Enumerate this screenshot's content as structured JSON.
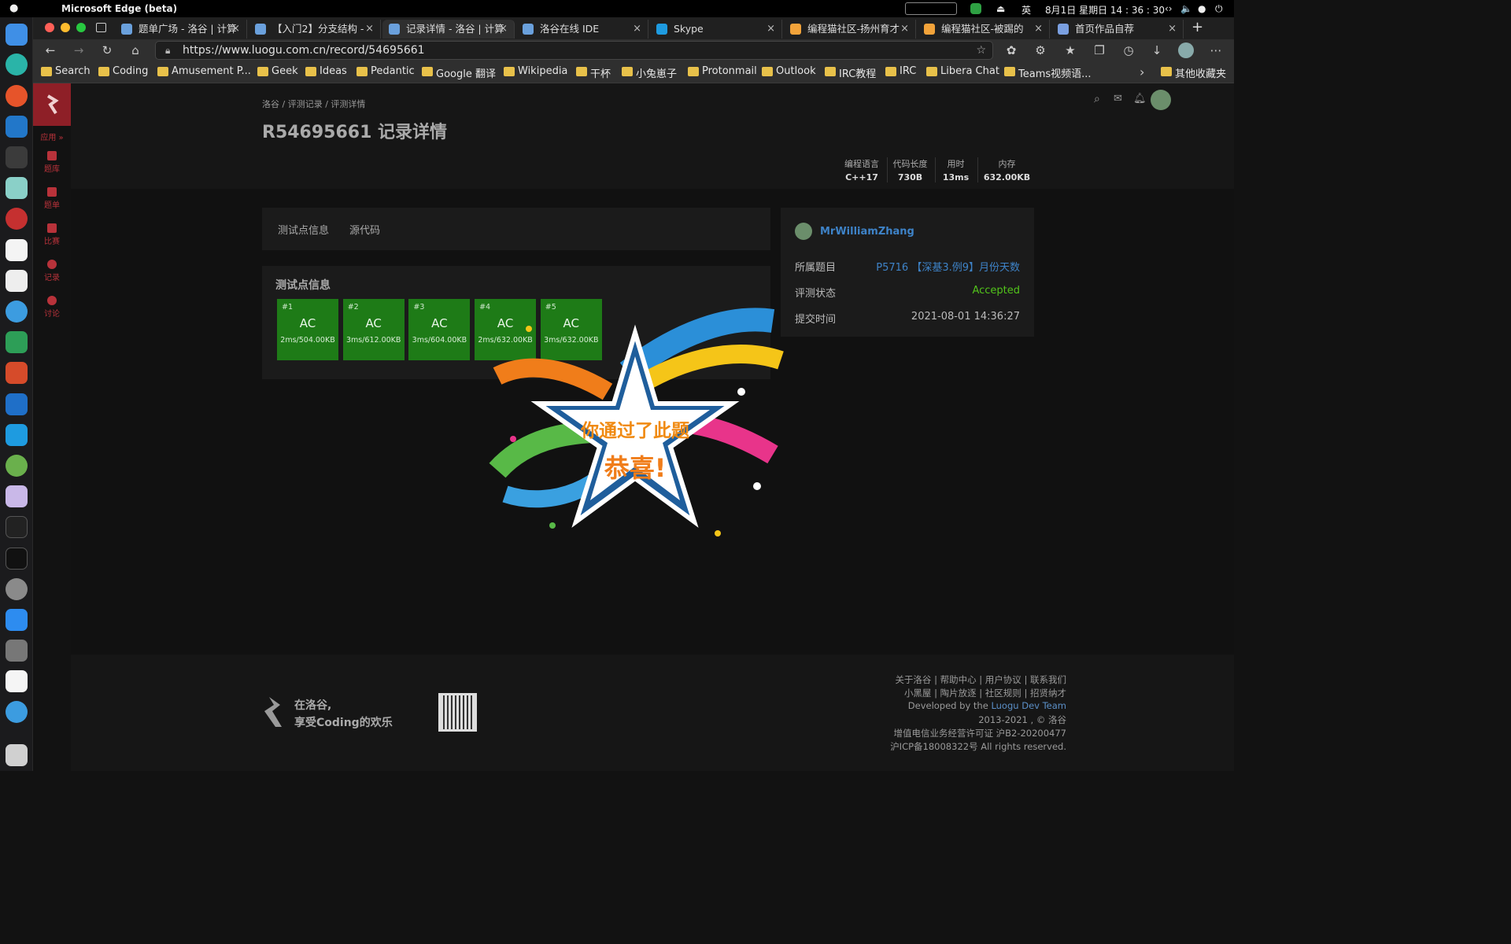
{
  "menubar": {
    "app_name": "Microsoft Edge (beta)",
    "ime": "英",
    "datetime": "8月1日 星期日 14 : 36 : 30"
  },
  "tabs": [
    {
      "title": "题单广场 - 洛谷 | 计算",
      "color": "#6aa0dc"
    },
    {
      "title": "【入门2】分支结构 -",
      "color": "#6aa0dc"
    },
    {
      "title": "记录详情 - 洛谷 | 计算",
      "color": "#6aa0dc"
    },
    {
      "title": "洛谷在线 IDE",
      "color": "#6aa0dc"
    },
    {
      "title": "Skype",
      "color": "#1e9be0"
    },
    {
      "title": "编程猫社区-扬州育才",
      "color": "#f2a33a"
    },
    {
      "title": "编程猫社区-被踢的",
      "color": "#f2a33a"
    },
    {
      "title": "首页作品自荐",
      "color": "#7a9fe0"
    }
  ],
  "url": "https://www.luogu.com.cn/record/54695661",
  "bookmarks": [
    "Search",
    "Coding",
    "Amusement P...",
    "Geek",
    "Ideas",
    "Pedantic",
    "Google 翻译",
    "Wikipedia",
    "干杯",
    "小兔崽子",
    "Protonmail",
    "Outlook",
    "IRC教程",
    "IRC",
    "Libera Chat",
    "Teams视频语...",
    "其他收藏夹"
  ],
  "sidenav": {
    "apps": "应用",
    "items": [
      "题库",
      "题单",
      "比赛",
      "记录",
      "讨论"
    ]
  },
  "breadcrumb": "洛谷 / 评测记录 / 评测详情",
  "page_title": "R54695661 记录详情",
  "stats": [
    {
      "label": "编程语言",
      "value": "C++17"
    },
    {
      "label": "代码长度",
      "value": "730B"
    },
    {
      "label": "用时",
      "value": "13ms"
    },
    {
      "label": "内存",
      "value": "632.00KB"
    }
  ],
  "content_tabs": [
    "测试点信息",
    "源代码"
  ],
  "testcase_heading": "测试点信息",
  "testcases": [
    {
      "id": "#1",
      "status": "AC",
      "detail": "2ms/504.00KB"
    },
    {
      "id": "#2",
      "status": "AC",
      "detail": "3ms/612.00KB"
    },
    {
      "id": "#3",
      "status": "AC",
      "detail": "3ms/604.00KB"
    },
    {
      "id": "#4",
      "status": "AC",
      "detail": "2ms/632.00KB"
    },
    {
      "id": "#5",
      "status": "AC",
      "detail": "3ms/632.00KB"
    }
  ],
  "info": {
    "username": "MrWilliamZhang",
    "problem_label": "所属题目",
    "problem_value": "P5716 【深基3.例9】月份天数",
    "status_label": "评测状态",
    "status_value": "Accepted",
    "time_label": "提交时间",
    "time_value": "2021-08-01 14:36:27"
  },
  "popup": {
    "line1": "你通过了此题",
    "line2": "恭喜!"
  },
  "footer": {
    "slogan1": "在洛谷,",
    "slogan2": "享受Coding的欢乐",
    "links1": "关于洛谷 | 帮助中心 | 用户协议 | 联系我们",
    "links2": "小黑屋 | 陶片放逐 | 社区规则 | 招贤纳才",
    "dev_prefix": "Developed by the",
    "dev_team": "Luogu Dev Team",
    "copyright": "2013-2021 , © 洛谷",
    "license1": "增值电信业务经营许可证 沪B2-20200477",
    "license2": "沪ICP备18008322号 All rights reserved."
  },
  "colors": {
    "accent": "#3e83c8",
    "ac_green": "#1e7b17",
    "accepted": "#52c41a",
    "luogu_red": "#8e1f27"
  }
}
